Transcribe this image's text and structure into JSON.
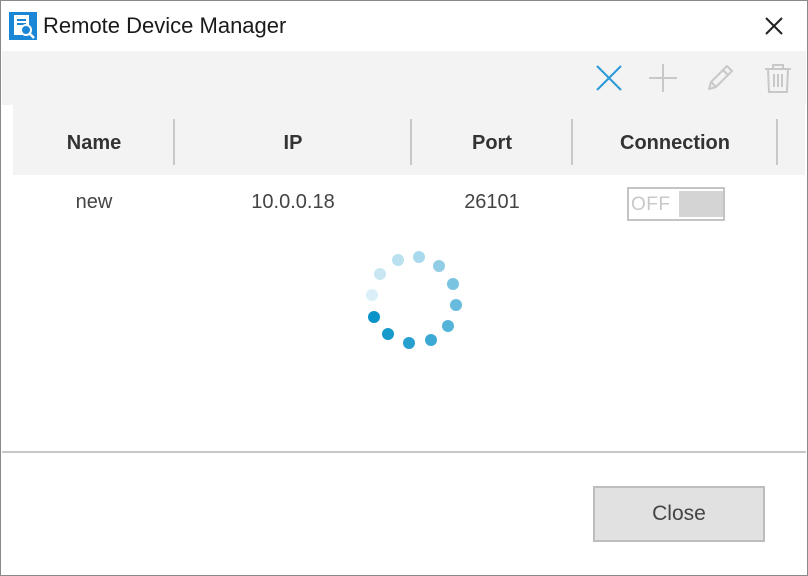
{
  "window": {
    "title": "Remote Device Manager",
    "icons": {
      "app": "device-manager-icon",
      "close": "close-icon"
    }
  },
  "toolbar": {
    "icons": [
      "cancel-x-icon",
      "add-plus-icon",
      "edit-pencil-icon",
      "delete-trash-icon"
    ],
    "accent_color": "#2d9ad9",
    "disabled_color": "#c8c8c8"
  },
  "table": {
    "columns": [
      "Name",
      "IP",
      "Port",
      "Connection"
    ],
    "rows": [
      {
        "name": "new",
        "ip": "10.0.0.18",
        "port": "26101",
        "connection": "OFF"
      }
    ]
  },
  "loading": {
    "icon": "loading-spinner-icon",
    "color": "#0a93c8"
  },
  "footer": {
    "close_label": "Close"
  }
}
